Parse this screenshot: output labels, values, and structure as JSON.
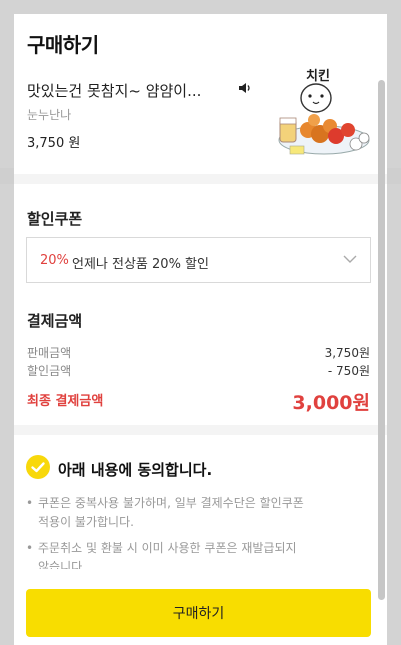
{
  "modal": {
    "title": "구매하기"
  },
  "product": {
    "name": "맛있는건 못참지~ 얌얌이...",
    "author": "눈누난나",
    "price": "3,750 원",
    "sticker_text": "치킨"
  },
  "coupon": {
    "section_title": "할인쿠폰",
    "selected_percent": "20%",
    "selected_text": "언제나 전상품 20% 할인"
  },
  "payment": {
    "section_title": "결제금액",
    "sale_label": "판매금액",
    "sale_value": "3,750원",
    "discount_label": "할인금액",
    "discount_value": "- 750원",
    "final_label": "최종 결제금액",
    "final_value": "3,000원"
  },
  "agreement": {
    "title": "아래 내용에 동의합니다.",
    "notices": [
      {
        "line1": "쿠폰은 중복사용 불가하며, 일부 결제수단은 할인쿠폰",
        "line2": "적용이 불가합니다."
      },
      {
        "line1": "주문취소 및 환불 시 이미 사용한 쿠폰은 재발급되지",
        "line2": "않습니다"
      }
    ]
  },
  "buy_button": {
    "label": "구매하기"
  },
  "colors": {
    "accent_yellow": "#f8dd00",
    "discount_red": "#e0413e"
  }
}
